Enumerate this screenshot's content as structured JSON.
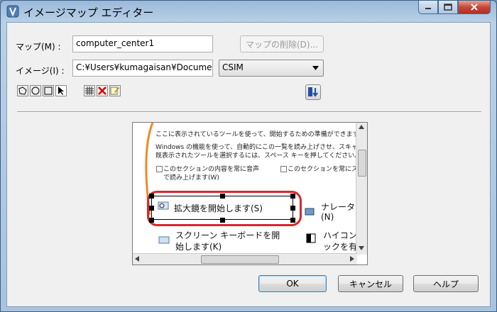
{
  "window": {
    "title": "イメージマップ エディター"
  },
  "form": {
    "map_label": "マップ(M) :",
    "map_value": "computer_center1",
    "delete_map_label": "マップの削除(D)...",
    "image_label": "イメージ(I) :",
    "image_value": "C:¥Users¥kumagaisan¥Docume",
    "format_value": "CSIM"
  },
  "preview": {
    "line1": "ここに表示されているツールを使って、開始するための準備ができます。",
    "line2": "Windows の機能を使って、自動的にこの一覧を読み上げさせ、スキャンさせ",
    "line3": "既表示されたツールを選択するには、スペース キーを押してください。",
    "check1a": "このセクションの内容を常に音声",
    "check1b": "で読み上げます(W)",
    "check2": "このセクションを常にスキャ",
    "magnifier": "拡大鏡を開始します(S)",
    "narrator_a": "ナレーターを",
    "narrator_b": "(N)",
    "keyboard_a": "スクリーン キーボードを開",
    "keyboard_b": "始します(K)",
    "contrast_a": "ハイコント",
    "contrast_b": "ックを有効"
  },
  "buttons": {
    "ok": "OK",
    "cancel": "キャンセル",
    "help": "ヘルプ"
  },
  "colors": {
    "selection_outline": "#d9262e",
    "accent": "#3c7fb1"
  }
}
